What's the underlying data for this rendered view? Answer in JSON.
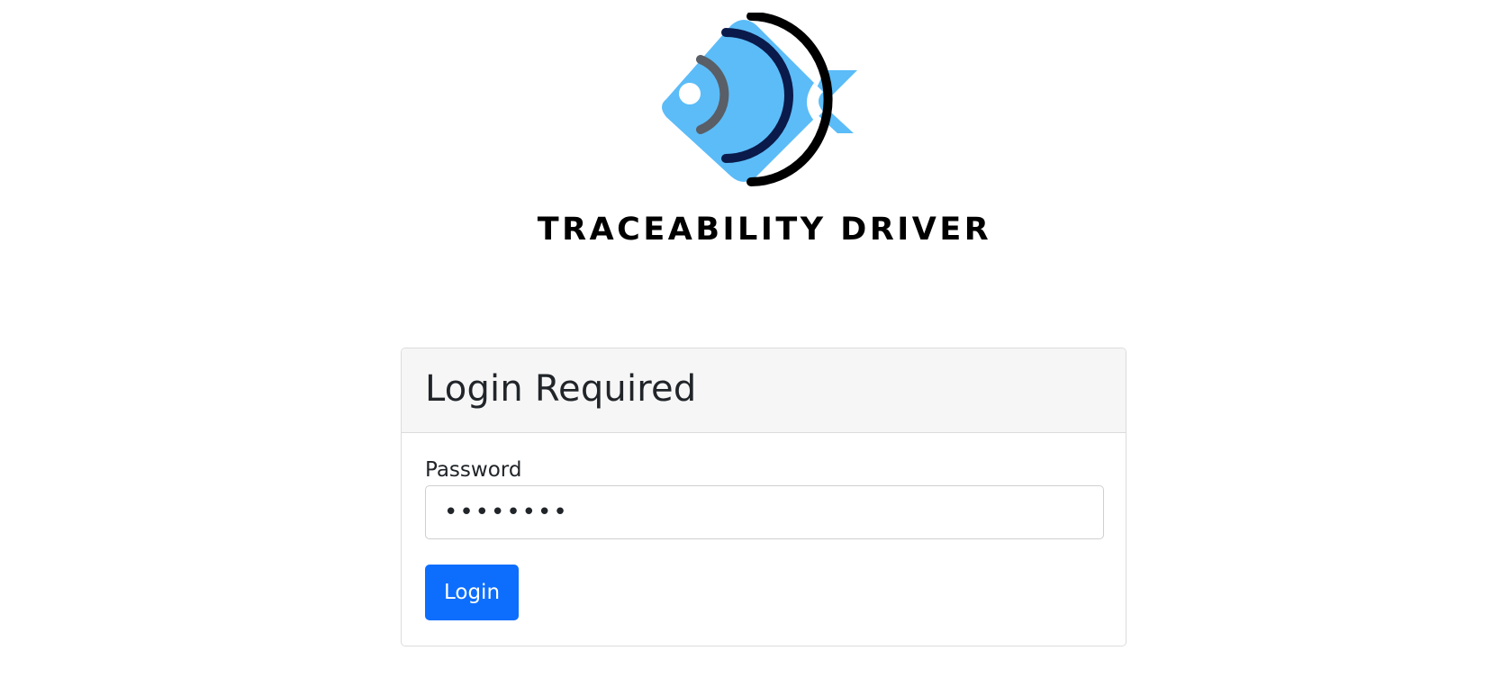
{
  "brand": {
    "name": "TRACEABILITY DRIVER",
    "logo_icon": "fish-signal-logo",
    "colors": {
      "fish_body": "#5bbcf8",
      "arc_inner": "#5a5e66",
      "arc_middle": "#0a1a4a",
      "arc_outer": "#000000"
    }
  },
  "login_card": {
    "title": "Login Required",
    "password_label": "Password",
    "password_value": "••••••••",
    "submit_label": "Login",
    "colors": {
      "header_bg": "#f6f6f6",
      "border": "#dcdcdc",
      "button_bg": "#0d6efd"
    }
  }
}
